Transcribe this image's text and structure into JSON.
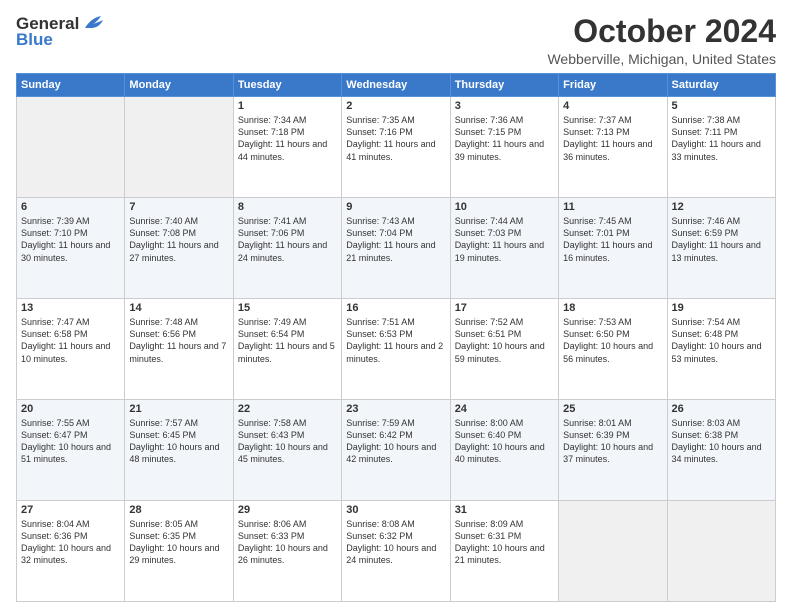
{
  "header": {
    "logo_general": "General",
    "logo_blue": "Blue",
    "title": "October 2024",
    "subtitle": "Webberville, Michigan, United States"
  },
  "weekdays": [
    "Sunday",
    "Monday",
    "Tuesday",
    "Wednesday",
    "Thursday",
    "Friday",
    "Saturday"
  ],
  "rows": [
    [
      {
        "day": "",
        "content": ""
      },
      {
        "day": "",
        "content": ""
      },
      {
        "day": "1",
        "content": "Sunrise: 7:34 AM\nSunset: 7:18 PM\nDaylight: 11 hours and 44 minutes."
      },
      {
        "day": "2",
        "content": "Sunrise: 7:35 AM\nSunset: 7:16 PM\nDaylight: 11 hours and 41 minutes."
      },
      {
        "day": "3",
        "content": "Sunrise: 7:36 AM\nSunset: 7:15 PM\nDaylight: 11 hours and 39 minutes."
      },
      {
        "day": "4",
        "content": "Sunrise: 7:37 AM\nSunset: 7:13 PM\nDaylight: 11 hours and 36 minutes."
      },
      {
        "day": "5",
        "content": "Sunrise: 7:38 AM\nSunset: 7:11 PM\nDaylight: 11 hours and 33 minutes."
      }
    ],
    [
      {
        "day": "6",
        "content": "Sunrise: 7:39 AM\nSunset: 7:10 PM\nDaylight: 11 hours and 30 minutes."
      },
      {
        "day": "7",
        "content": "Sunrise: 7:40 AM\nSunset: 7:08 PM\nDaylight: 11 hours and 27 minutes."
      },
      {
        "day": "8",
        "content": "Sunrise: 7:41 AM\nSunset: 7:06 PM\nDaylight: 11 hours and 24 minutes."
      },
      {
        "day": "9",
        "content": "Sunrise: 7:43 AM\nSunset: 7:04 PM\nDaylight: 11 hours and 21 minutes."
      },
      {
        "day": "10",
        "content": "Sunrise: 7:44 AM\nSunset: 7:03 PM\nDaylight: 11 hours and 19 minutes."
      },
      {
        "day": "11",
        "content": "Sunrise: 7:45 AM\nSunset: 7:01 PM\nDaylight: 11 hours and 16 minutes."
      },
      {
        "day": "12",
        "content": "Sunrise: 7:46 AM\nSunset: 6:59 PM\nDaylight: 11 hours and 13 minutes."
      }
    ],
    [
      {
        "day": "13",
        "content": "Sunrise: 7:47 AM\nSunset: 6:58 PM\nDaylight: 11 hours and 10 minutes."
      },
      {
        "day": "14",
        "content": "Sunrise: 7:48 AM\nSunset: 6:56 PM\nDaylight: 11 hours and 7 minutes."
      },
      {
        "day": "15",
        "content": "Sunrise: 7:49 AM\nSunset: 6:54 PM\nDaylight: 11 hours and 5 minutes."
      },
      {
        "day": "16",
        "content": "Sunrise: 7:51 AM\nSunset: 6:53 PM\nDaylight: 11 hours and 2 minutes."
      },
      {
        "day": "17",
        "content": "Sunrise: 7:52 AM\nSunset: 6:51 PM\nDaylight: 10 hours and 59 minutes."
      },
      {
        "day": "18",
        "content": "Sunrise: 7:53 AM\nSunset: 6:50 PM\nDaylight: 10 hours and 56 minutes."
      },
      {
        "day": "19",
        "content": "Sunrise: 7:54 AM\nSunset: 6:48 PM\nDaylight: 10 hours and 53 minutes."
      }
    ],
    [
      {
        "day": "20",
        "content": "Sunrise: 7:55 AM\nSunset: 6:47 PM\nDaylight: 10 hours and 51 minutes."
      },
      {
        "day": "21",
        "content": "Sunrise: 7:57 AM\nSunset: 6:45 PM\nDaylight: 10 hours and 48 minutes."
      },
      {
        "day": "22",
        "content": "Sunrise: 7:58 AM\nSunset: 6:43 PM\nDaylight: 10 hours and 45 minutes."
      },
      {
        "day": "23",
        "content": "Sunrise: 7:59 AM\nSunset: 6:42 PM\nDaylight: 10 hours and 42 minutes."
      },
      {
        "day": "24",
        "content": "Sunrise: 8:00 AM\nSunset: 6:40 PM\nDaylight: 10 hours and 40 minutes."
      },
      {
        "day": "25",
        "content": "Sunrise: 8:01 AM\nSunset: 6:39 PM\nDaylight: 10 hours and 37 minutes."
      },
      {
        "day": "26",
        "content": "Sunrise: 8:03 AM\nSunset: 6:38 PM\nDaylight: 10 hours and 34 minutes."
      }
    ],
    [
      {
        "day": "27",
        "content": "Sunrise: 8:04 AM\nSunset: 6:36 PM\nDaylight: 10 hours and 32 minutes."
      },
      {
        "day": "28",
        "content": "Sunrise: 8:05 AM\nSunset: 6:35 PM\nDaylight: 10 hours and 29 minutes."
      },
      {
        "day": "29",
        "content": "Sunrise: 8:06 AM\nSunset: 6:33 PM\nDaylight: 10 hours and 26 minutes."
      },
      {
        "day": "30",
        "content": "Sunrise: 8:08 AM\nSunset: 6:32 PM\nDaylight: 10 hours and 24 minutes."
      },
      {
        "day": "31",
        "content": "Sunrise: 8:09 AM\nSunset: 6:31 PM\nDaylight: 10 hours and 21 minutes."
      },
      {
        "day": "",
        "content": ""
      },
      {
        "day": "",
        "content": ""
      }
    ]
  ]
}
